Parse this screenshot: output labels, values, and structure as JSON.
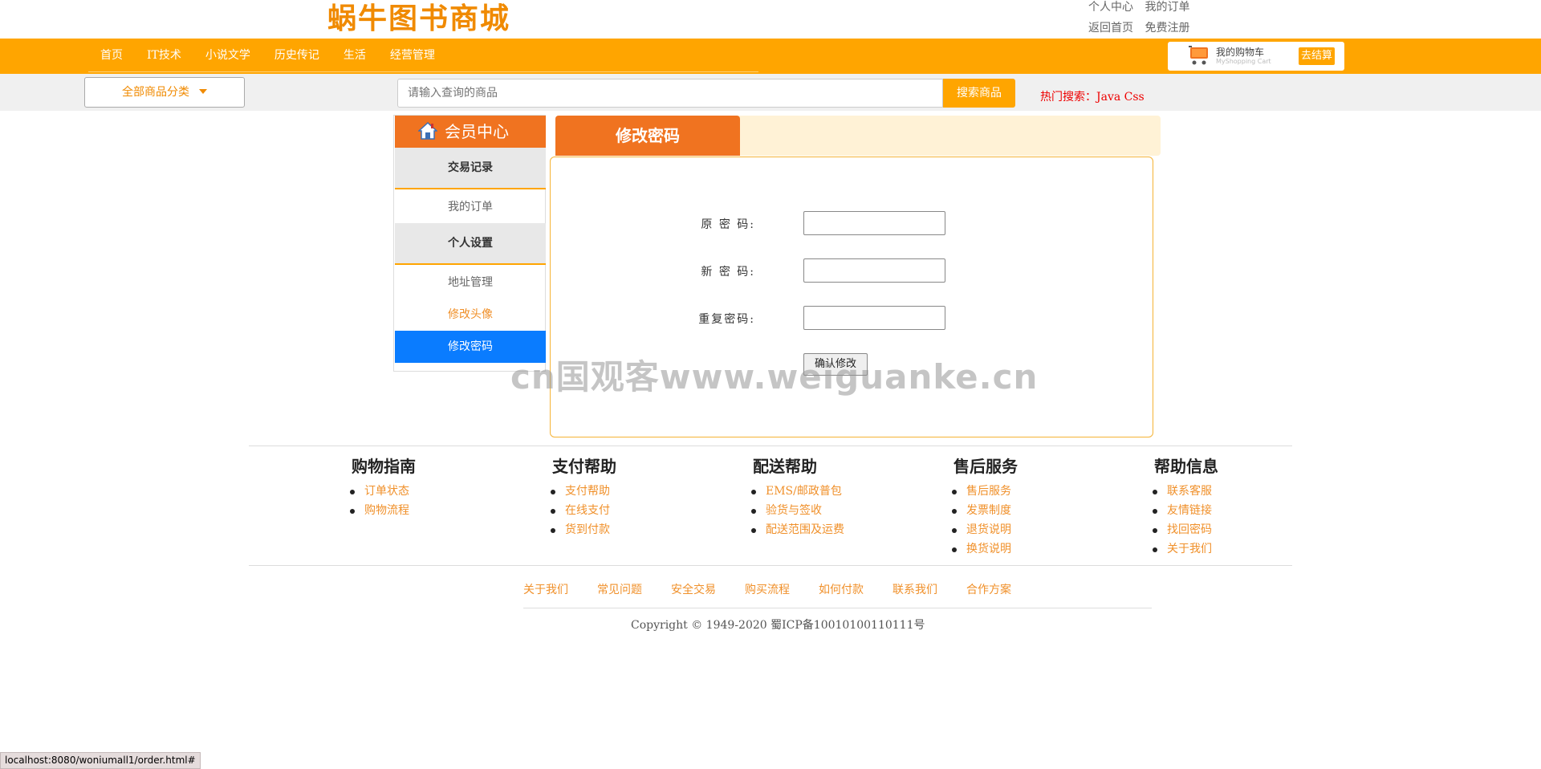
{
  "header": {
    "logo": "蜗牛图书商城",
    "top_links_row1": [
      "个人中心",
      "我的订单"
    ],
    "top_links_row2": [
      "返回首页",
      "免费注册"
    ]
  },
  "nav": {
    "items": [
      "首页",
      "IT技术",
      "小说文学",
      "历史传记",
      "生活",
      "经营管理"
    ],
    "cart_title": "我的购物车",
    "cart_subtitle": "MyShopping Cart",
    "checkout_label": "去结算"
  },
  "search": {
    "category_label": "全部商品分类",
    "placeholder": "请输入查询的商品",
    "button_label": "搜索商品",
    "hot_label": "热门搜索：Java Css"
  },
  "sidebar": {
    "title": "会员中心",
    "section1": "交易记录",
    "my_orders": "我的订单",
    "section2": "个人设置",
    "address": "地址管理",
    "avatar": "修改头像",
    "password": "修改密码"
  },
  "panel": {
    "title": "修改密码",
    "old_password_label": "原 密 码:",
    "new_password_label": "新 密 码:",
    "repeat_password_label": "重复密码:",
    "submit_label": "确认修改"
  },
  "footer": {
    "columns": [
      {
        "title": "购物指南",
        "items": [
          "订单状态",
          "购物流程"
        ]
      },
      {
        "title": "支付帮助",
        "items": [
          "支付帮助",
          "在线支付",
          "货到付款"
        ]
      },
      {
        "title": "配送帮助",
        "items": [
          "EMS/邮政普包",
          "验货与签收",
          "配送范围及运费"
        ]
      },
      {
        "title": "售后服务",
        "items": [
          "售后服务",
          "发票制度",
          "退货说明",
          "换货说明"
        ]
      },
      {
        "title": "帮助信息",
        "items": [
          "联系客服",
          "友情链接",
          "找回密码",
          "关于我们"
        ]
      }
    ],
    "bottom_links": [
      "关于我们",
      "常见问题",
      "安全交易",
      "购买流程",
      "如何付款",
      "联系我们",
      "合作方案"
    ],
    "copyright": "Copyright © 1949-2020 蜀ICP备10010100110111号"
  },
  "status_bar": "localhost:8080/woniumall1/order.html#",
  "watermark": "cn国观客www.weiguanke.cn",
  "colors": {
    "brand_orange": "#ffa500",
    "tab_orange": "#f07320",
    "active_blue": "#0a7cff"
  }
}
